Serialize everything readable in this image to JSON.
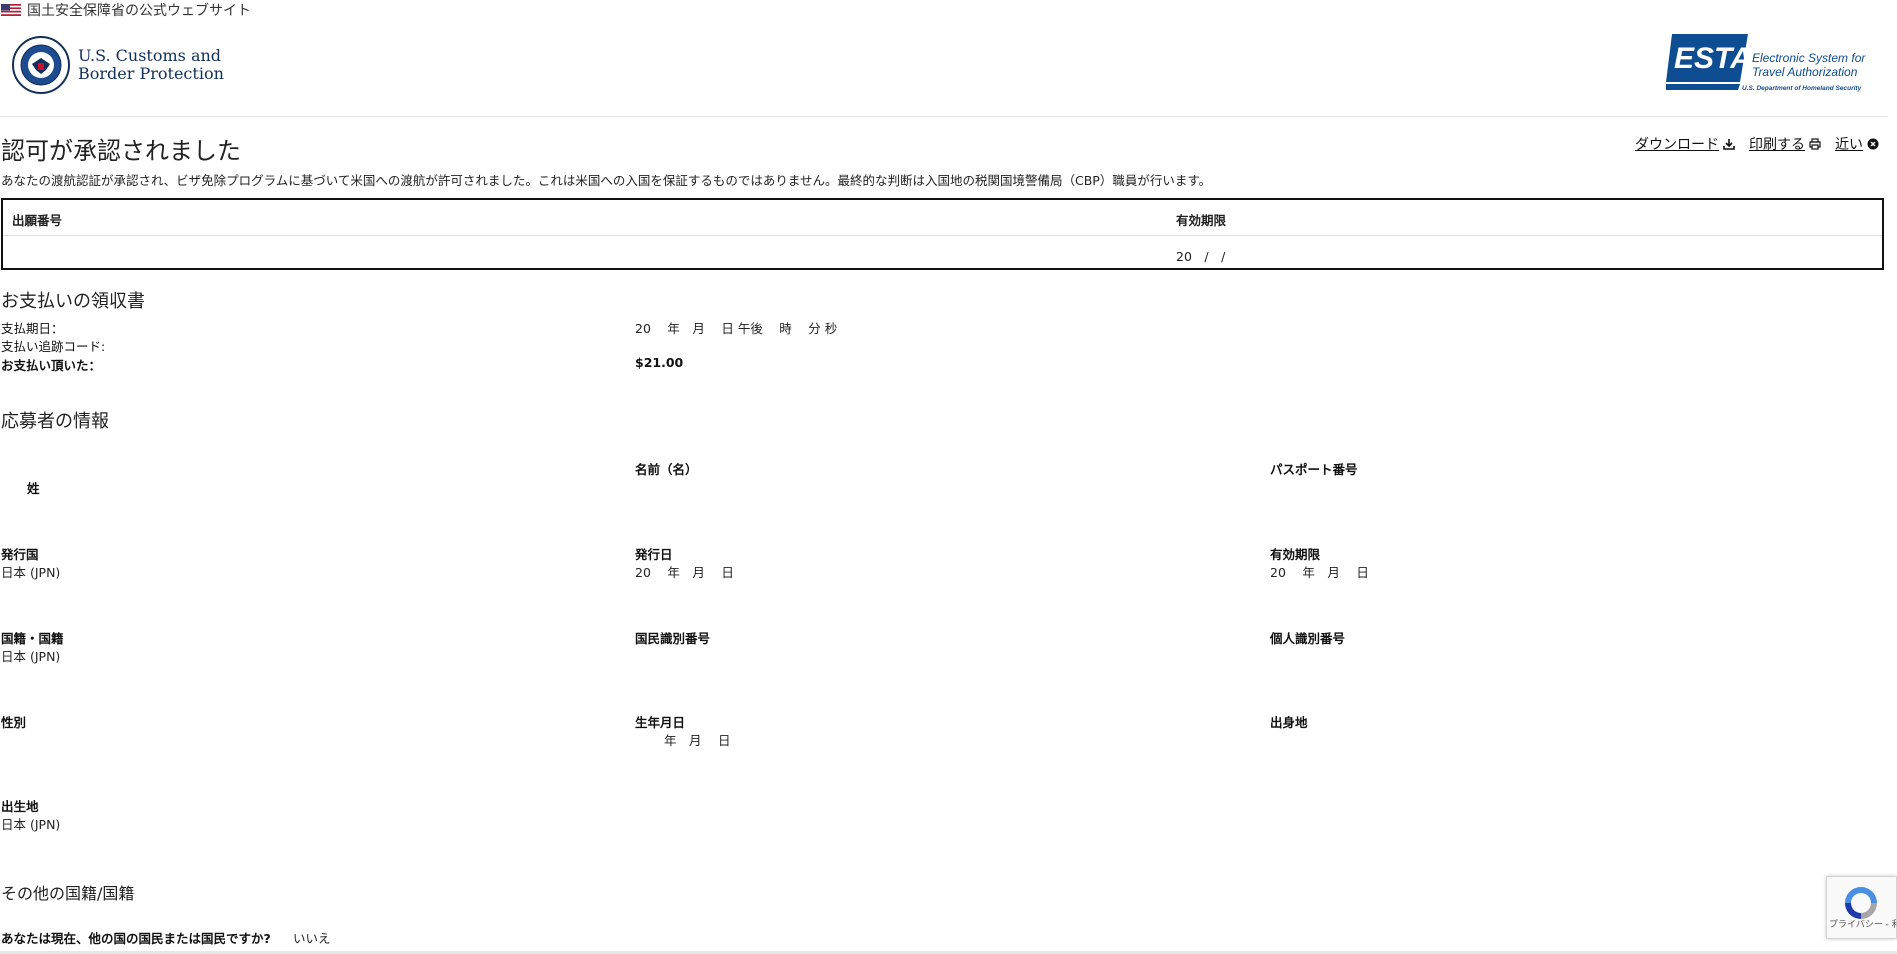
{
  "banner": {
    "text": "国土安全保障省の公式ウェブサイト",
    "flag_icon": "us-flag-icon"
  },
  "header": {
    "cbp_line1": "U.S. Customs and",
    "cbp_line2": "Border Protection",
    "esta_logo_text": "ESTA",
    "esta_line1": "Electronic System for",
    "esta_line2": "Travel Authorization",
    "esta_line3": "U.S. Department of Homeland Security"
  },
  "page": {
    "title": "認可が承認されました",
    "intro": "あなたの渡航認証が承認され、ビザ免除プログラムに基づいて米国への渡航が許可されました。これは米国への入国を保証するものではありません。最終的な判断は入国地の税関国境警備局（CBP）職員が行います。"
  },
  "actions": {
    "download": "ダウンロード",
    "print": "印刷する",
    "close": "近い"
  },
  "reference": {
    "app_number_label": "出願番号",
    "app_number_value": "",
    "expiry_label": "有効期限",
    "expiry_value": "20　/　/"
  },
  "payment": {
    "heading": "お支払いの領収書",
    "date_label": "支払期日：",
    "date_value": "20　 年　月　 日 午後　 時　 分 秒",
    "tracking_label": "支払い追跡コード:",
    "tracking_value": "",
    "amount_label": "お支払い頂いた：",
    "amount_value": "$21.00"
  },
  "applicant": {
    "heading": "応募者の情報",
    "surname_label": "姓",
    "given_name_label": "名前（名）",
    "passport_label": "パスポート番号",
    "issuing_country_label": "発行国",
    "issuing_country_value": "日本 (JPN)",
    "issue_date_label": "発行日",
    "issue_date_value": "20　 年　月　 日",
    "expiry_label": "有効期限",
    "expiry_value": "20　 年　月　 日",
    "citizenship_label": "国籍・国籍",
    "citizenship_value": "日本 (JPN)",
    "national_id_label": "国民識別番号",
    "personal_id_label": "個人識別番号",
    "sex_label": "性別",
    "birth_date_label": "生年月日",
    "birth_date_value": "年　月　 日",
    "birth_city_label": "出身地",
    "birth_country_label": "出生地",
    "birth_country_value": "日本 (JPN)"
  },
  "other_citizenship": {
    "heading": "その他の国籍/国籍",
    "question": "あなたは現在、他の国の国民または国民ですか?",
    "answer": "いいえ"
  },
  "recaptcha": {
    "text": "プライバシー - 利用規約"
  }
}
